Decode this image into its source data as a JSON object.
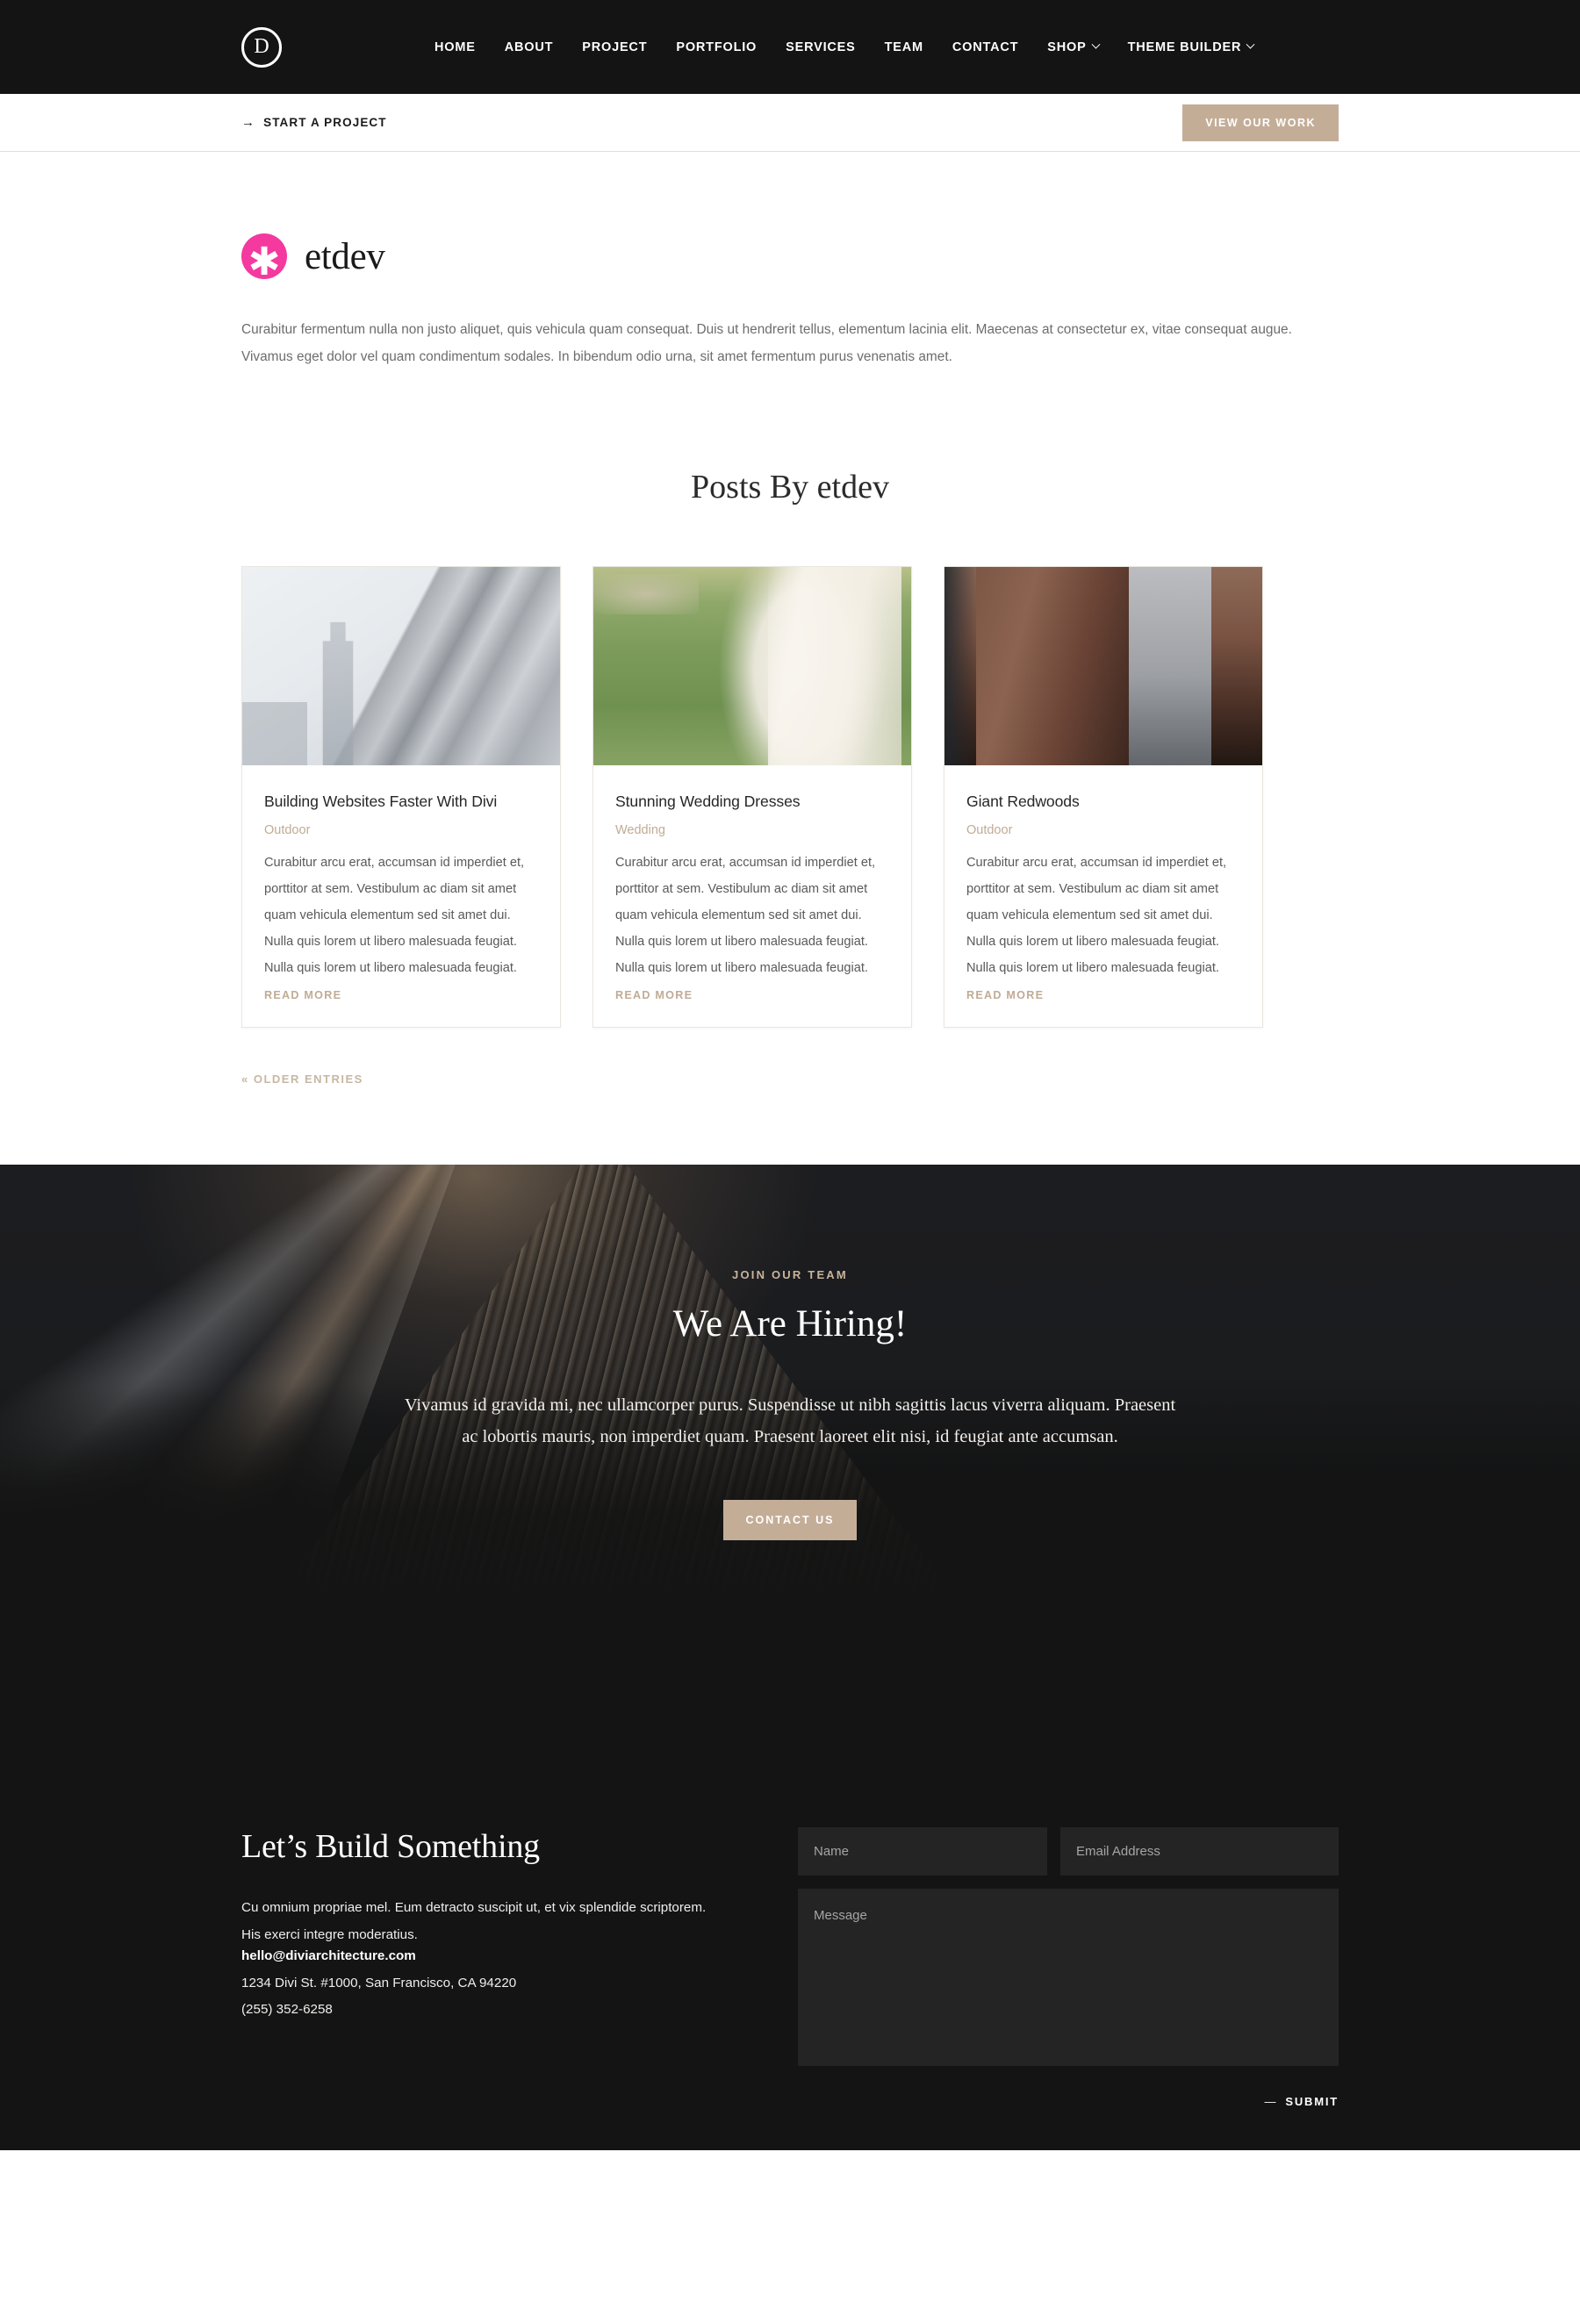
{
  "nav": {
    "logo_letter": "D",
    "items": [
      {
        "label": "HOME",
        "has_dropdown": false
      },
      {
        "label": "ABOUT",
        "has_dropdown": false
      },
      {
        "label": "PROJECT",
        "has_dropdown": false
      },
      {
        "label": "PORTFOLIO",
        "has_dropdown": false
      },
      {
        "label": "SERVICES",
        "has_dropdown": false
      },
      {
        "label": "TEAM",
        "has_dropdown": false
      },
      {
        "label": "CONTACT",
        "has_dropdown": false
      },
      {
        "label": "SHOP",
        "has_dropdown": true
      },
      {
        "label": "THEME BUILDER",
        "has_dropdown": true
      }
    ]
  },
  "subbar": {
    "arrow": "→",
    "start_project_label": "START A PROJECT",
    "view_work_label": "VIEW OUR WORK"
  },
  "author": {
    "avatar_glyph": "✱",
    "avatar_color": "#f4399f",
    "name": "etdev",
    "bio": "Curabitur fermentum nulla non justo aliquet, quis vehicula quam consequat. Duis ut hendrerit tellus, elementum lacinia elit. Maecenas at consectetur ex, vitae consequat augue. Vivamus eget dolor vel quam condimentum sodales. In bibendum odio urna, sit amet fermentum purus venenatis amet."
  },
  "posts": {
    "heading": "Posts By etdev",
    "read_more_label": "READ MORE",
    "older_entries_label": "« OLDER ENTRIES",
    "items": [
      {
        "title": "Building Websites Faster With Divi",
        "category": "Outdoor",
        "excerpt": "Curabitur arcu erat, accumsan id imperdiet et, porttitor at sem. Vestibulum ac diam sit amet quam vehicula elementum sed sit amet dui. Nulla quis lorem ut libero malesuada feugiat. Nulla quis lorem ut libero malesuada feugiat.",
        "image": "city-skyline-fog"
      },
      {
        "title": "Stunning Wedding Dresses",
        "category": "Wedding",
        "excerpt": "Curabitur arcu erat, accumsan id imperdiet et, porttitor at sem. Vestibulum ac diam sit amet quam vehicula elementum sed sit amet dui. Nulla quis lorem ut libero malesuada feugiat. Nulla quis lorem ut libero malesuada feugiat.",
        "image": "bride-in-grass"
      },
      {
        "title": "Giant Redwoods",
        "category": "Outdoor",
        "excerpt": "Curabitur arcu erat, accumsan id imperdiet et, porttitor at sem. Vestibulum ac diam sit amet quam vehicula elementum sed sit amet dui. Nulla quis lorem ut libero malesuada feugiat. Nulla quis lorem ut libero malesuada feugiat.",
        "image": "redwood-trees-fog"
      }
    ]
  },
  "hiring": {
    "eyebrow": "JOIN OUR TEAM",
    "heading": "We Are Hiring!",
    "paragraph": "Vivamus id gravida mi, nec ullamcorper purus. Suspendisse ut nibh sagittis lacus viverra aliquam. Praesent ac lobortis mauris, non imperdiet quam. Praesent laoreet elit nisi, id feugiat ante accumsan.",
    "button_label": "CONTACT US"
  },
  "footer": {
    "heading": "Let’s Build Something",
    "paragraph": "Cu omnium propriae mel. Eum detracto suscipit ut, et vix splendide scriptorem. His exerci integre moderatius.",
    "email": "hello@diviarchitecture.com",
    "address": "1234 Divi St. #1000, San Francisco, CA 94220",
    "phone": "(255) 352-6258",
    "form": {
      "name_placeholder": "Name",
      "name_value": "",
      "email_placeholder": "Email Address",
      "email_value": "",
      "message_placeholder": "Message",
      "message_value": "",
      "submit_dash": "—",
      "submit_label": "SUBMIT"
    }
  },
  "colors": {
    "accent_tan": "#c4ad97",
    "dark": "#141414",
    "pink": "#f4399f"
  }
}
